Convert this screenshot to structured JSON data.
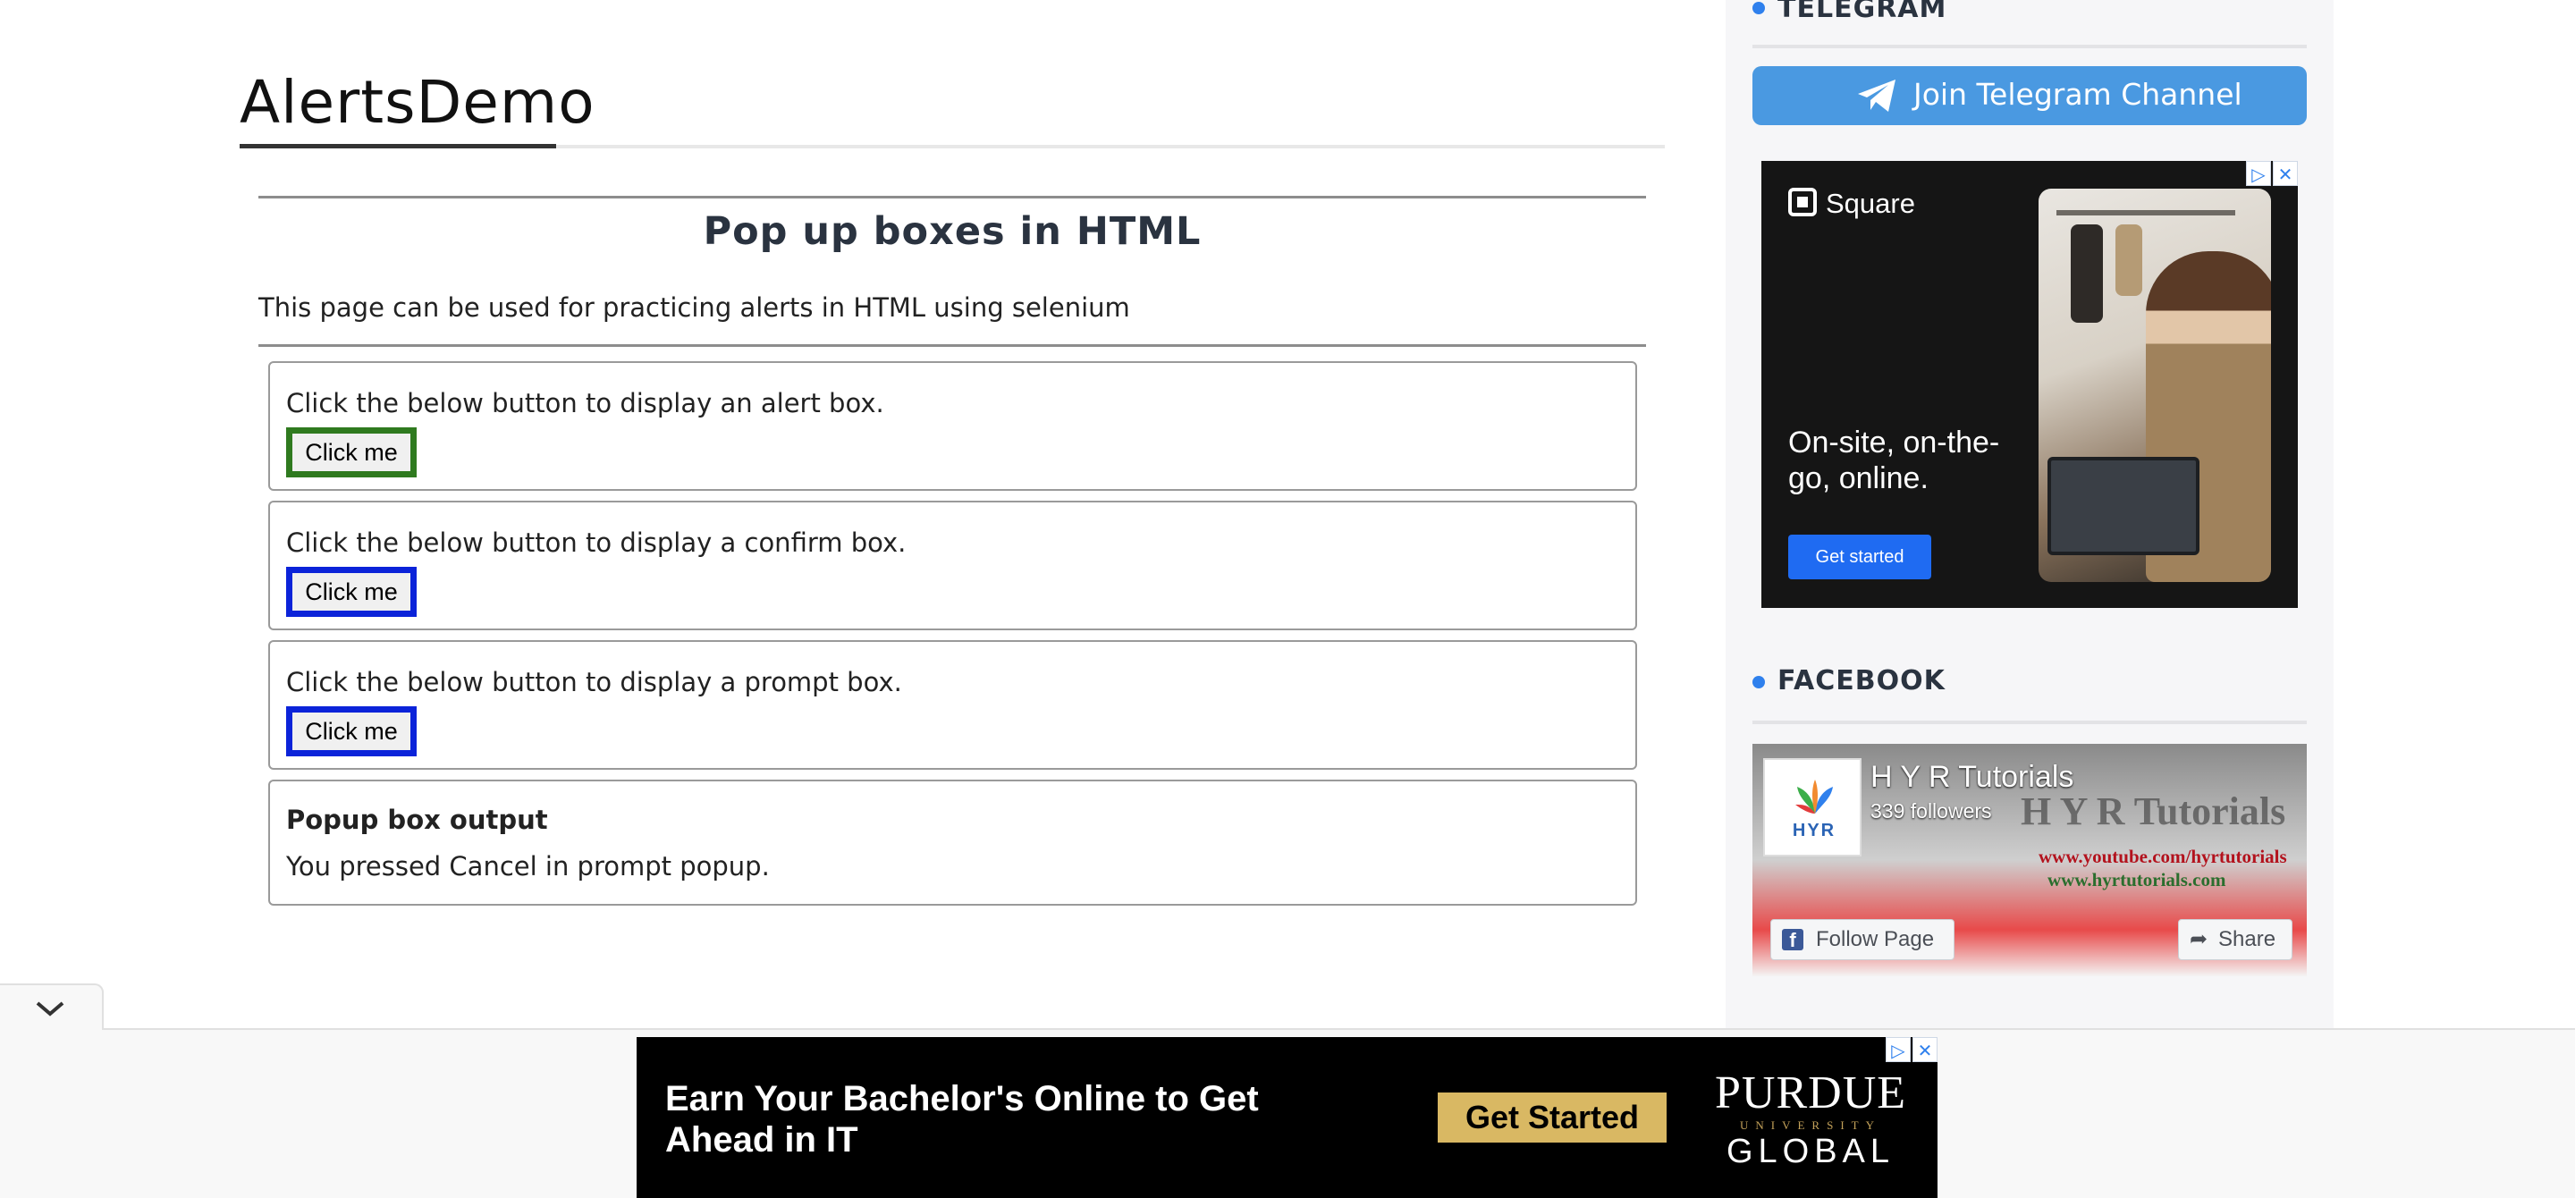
{
  "page": {
    "title": "AlertsDemo",
    "section_heading": "Pop up boxes in HTML",
    "intro": "This page can be used for practicing alerts in HTML using selenium"
  },
  "boxes": [
    {
      "text": "Click the below button to display an alert box.",
      "button": "Click me"
    },
    {
      "text": "Click the below button to display a confirm box.",
      "button": "Click me"
    },
    {
      "text": "Click the below button to display a prompt box.",
      "button": "Click me"
    }
  ],
  "output": {
    "title": "Popup box output",
    "text": "You pressed Cancel in prompt popup."
  },
  "sidebar": {
    "telegram": {
      "heading": "TELEGRAM",
      "button": "Join Telegram Channel"
    },
    "ad": {
      "brand": "Square",
      "headline": "On-site, on-the-go, online.",
      "cta": "Get started"
    },
    "facebook": {
      "heading": "FACEBOOK",
      "page_name": "H Y R Tutorials",
      "followers": "339 followers",
      "banner_title": "H Y R Tutorials",
      "banner_url1": "www.youtube.com/hyrtutorials",
      "banner_url2": "www.hyrtutorials.com",
      "logo_text": "HYR",
      "follow_button": "Follow Page",
      "share_button": "Share"
    }
  },
  "bottom_ad": {
    "message": "Earn Your Bachelor's Online to Get Ahead in IT",
    "cta": "Get Started",
    "logo_line1": "PURDUE",
    "logo_line2": "UNIVERSITY",
    "logo_line3": "GLOBAL"
  },
  "colors": {
    "alert_button_border": "#2f7a1f",
    "confirm_button_border": "#0b23d9",
    "prompt_button_border": "#0b23d9",
    "telegram_button": "#4a99e1",
    "accent_dot": "#2f80ed"
  },
  "icons": [
    "telegram-icon",
    "adchoices-icon",
    "close-icon",
    "facebook-icon",
    "share-icon",
    "chevron-down-icon"
  ]
}
